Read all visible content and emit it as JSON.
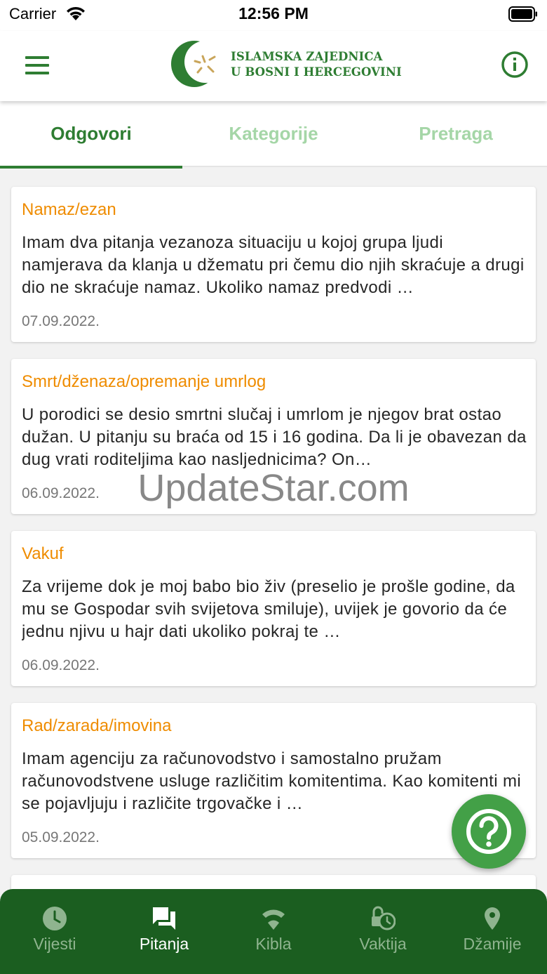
{
  "status_bar": {
    "carrier": "Carrier",
    "time": "12:56 PM"
  },
  "header": {
    "logo_line1": "ISLAMSKA ZAJEDNICA",
    "logo_line2": "U BOSNI I HERCEGOVINI",
    "menu_icon": "hamburger-menu-icon",
    "info_icon": "info-circle-icon"
  },
  "tabs": [
    {
      "label": "Odgovori",
      "active": true
    },
    {
      "label": "Kategorije",
      "active": false
    },
    {
      "label": "Pretraga",
      "active": false
    }
  ],
  "answers": [
    {
      "category": "Namaz/ezan",
      "text": "Imam dva pitanja vezanoza situaciju u kojoj grupa ljudi namjerava da klanja u džematu pri čemu dio njih skraćuje a drugi dio ne skraćuje namaz. Ukoliko namaz predvodi …",
      "date": "07.09.2022."
    },
    {
      "category": "Smrt/dženaza/opremanje umrlog",
      "text": "U porodici se desio smrtni slučaj i umrlom je njegov brat ostao dužan. U pitanju su braća od 15 i 16 godina. Da li je obavezan da dug vrati roditeljima kao nasljednicima? On…",
      "date": "06.09.2022."
    },
    {
      "category": "Vakuf",
      "text": "Za vrijeme dok je moj babo bio živ (preselio je prošle godine, da mu se Gospodar svih svijetova smiluje), uvijek je govorio da će jednu njivu u hajr dati ukoliko pokraj te …",
      "date": "06.09.2022."
    },
    {
      "category": "Rad/zarada/imovina",
      "text": "Imam agenciju za računovodstvo i samostalno pružam računovodstvene usluge različitim komitentima. Kao komitenti mi se pojavljuju i različite trgovačke i …",
      "date": "05.09.2022."
    }
  ],
  "watermark": "UpdateStar.com",
  "fab": {
    "icon": "question-mark-icon"
  },
  "bottom_nav": [
    {
      "label": "Vijesti",
      "icon": "clock-icon",
      "active": false
    },
    {
      "label": "Pitanja",
      "icon": "chat-bubbles-icon",
      "active": true
    },
    {
      "label": "Kibla",
      "icon": "compass-wifi-icon",
      "active": false
    },
    {
      "label": "Vaktija",
      "icon": "timer-lock-icon",
      "active": false
    },
    {
      "label": "Džamije",
      "icon": "location-pin-icon",
      "active": false
    }
  ],
  "colors": {
    "primary": "#2e7d32",
    "nav_background": "#1b5e20",
    "category": "#ef8c00",
    "fab": "#43a047"
  }
}
